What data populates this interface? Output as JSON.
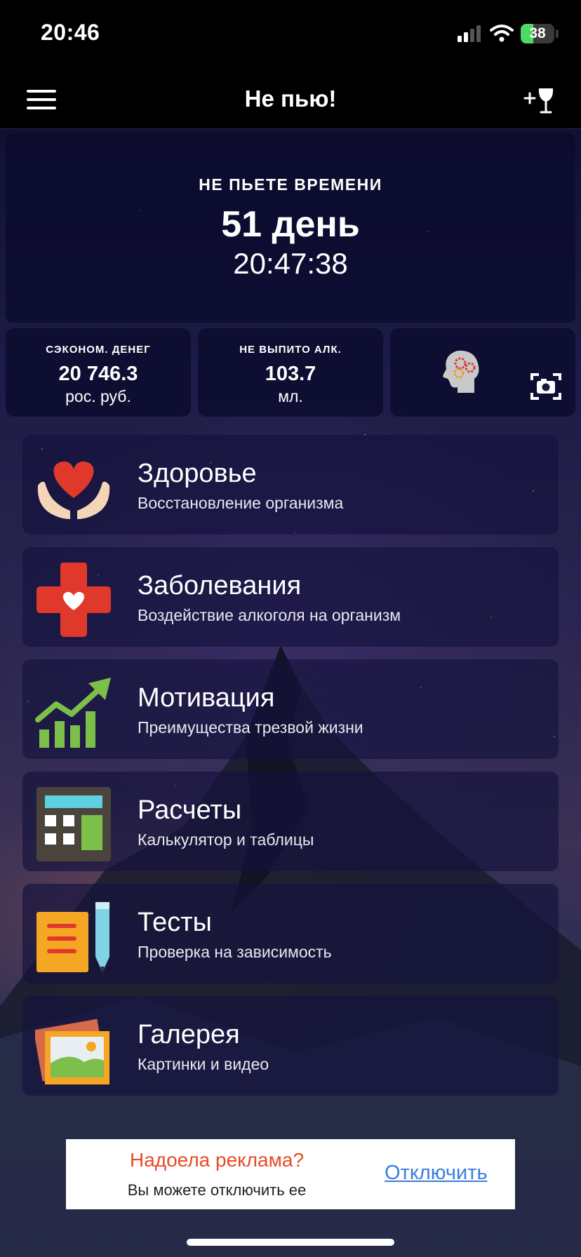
{
  "status_bar": {
    "time": "20:46",
    "battery": "38",
    "battery_level": 0.38
  },
  "navbar": {
    "title": "Не пью!",
    "menu_icon": "hamburger-menu-icon",
    "add_icon": "add-drink-wineglass-icon"
  },
  "timer": {
    "label": "НЕ ПЬЕТЕ ВРЕМЕНИ",
    "days": "51 день",
    "clock": "20:47:38"
  },
  "stats": {
    "money": {
      "label": "СЭКОНОМ. ДЕНЕГ",
      "value": "20 746.3",
      "unit": "рос. руб."
    },
    "alcohol": {
      "label": "НЕ ВЫПИТО АЛК.",
      "value": "103.7",
      "unit": "мл."
    }
  },
  "menu": [
    {
      "title": "Здоровье",
      "subtitle": "Восстановление организма",
      "icon": "heart-hands-icon"
    },
    {
      "title": "Заболевания",
      "subtitle": "Воздействие алкоголя на организм",
      "icon": "medical-cross-icon"
    },
    {
      "title": "Мотивация",
      "subtitle": "Преимущества трезвой жизни",
      "icon": "growth-chart-icon"
    },
    {
      "title": "Расчеты",
      "subtitle": "Калькулятор и таблицы",
      "icon": "calculator-icon"
    },
    {
      "title": "Тесты",
      "subtitle": "Проверка на зависимость",
      "icon": "notepad-pencil-icon"
    },
    {
      "title": "Галерея",
      "subtitle": "Картинки и видео",
      "icon": "photo-gallery-icon"
    }
  ],
  "ad": {
    "title": "Надоела реклама?",
    "subtitle": "Вы можете отключить ее",
    "link": "Отключить"
  },
  "colors": {
    "ad_title": "#e84a25",
    "ad_link": "#3a7de0",
    "battery": "#4cd964"
  }
}
